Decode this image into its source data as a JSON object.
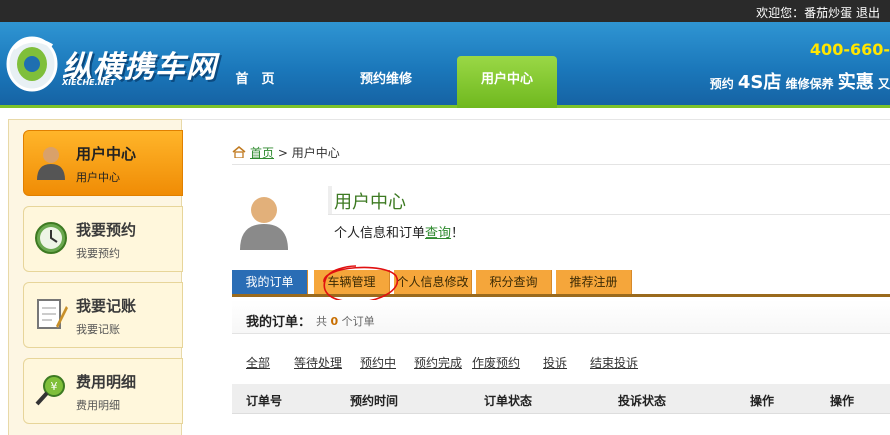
{
  "topbar": {
    "welcome_prefix": "欢迎您：",
    "username": "番茄炒蛋",
    "logout": "退出"
  },
  "header": {
    "logo_text": "纵横携车网",
    "logo_sub": "XIECHE.NET",
    "nav": [
      "首　页",
      "预约维修",
      "用户中心"
    ],
    "hotline": "400-660-",
    "slogan_a": "预约",
    "slogan_b": "4S店",
    "slogan_c": "维修保养",
    "slogan_d": "实惠",
    "slogan_e": "又"
  },
  "sidebar": {
    "items": [
      {
        "title": "用户中心",
        "sub": "用户中心",
        "icon": "user-icon"
      },
      {
        "title": "我要预约",
        "sub": "我要预约",
        "icon": "clock-icon"
      },
      {
        "title": "我要记账",
        "sub": "我要记账",
        "icon": "notepad-icon"
      },
      {
        "title": "费用明细",
        "sub": "费用明细",
        "icon": "money-magnifier-icon"
      }
    ]
  },
  "breadcrumb": {
    "home": "首页",
    "sep": " > ",
    "current": "用户中心"
  },
  "profile": {
    "title": "用户中心",
    "subtitle_prefix": "个人信息和订单",
    "subtitle_link": "查询",
    "subtitle_suffix": "！"
  },
  "tabs": [
    "我的订单",
    "车辆管理",
    "个人信息修改",
    "积分查询",
    "推荐注册"
  ],
  "orders": {
    "label": "我的订单：",
    "count_prefix": "共",
    "count": "0",
    "count_suffix": "个订单"
  },
  "filters": [
    "全部",
    "等待处理",
    "预约中",
    "预约完成",
    "作废预约",
    "投诉",
    "结束投诉"
  ],
  "table": {
    "headers": [
      "订单号",
      "预约时间",
      "订单状态",
      "投诉状态",
      "操作",
      "操作"
    ]
  },
  "colors": {
    "header_blue": "#1a76b9",
    "nav_active": "#7dc22a",
    "tab_orange": "#f5a63b",
    "tab_active": "#2a6db5",
    "annotation_red": "#e01010"
  }
}
